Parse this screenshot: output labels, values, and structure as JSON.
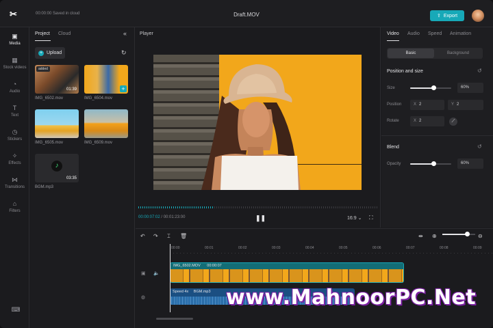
{
  "topbar": {
    "saved_text": "00:00:00 Saved in cloud",
    "title": "Draft.MOV",
    "export_label": "Export"
  },
  "rail": [
    {
      "label": "Media",
      "icon": "media-icon"
    },
    {
      "label": "Stock videos",
      "icon": "stock-icon"
    },
    {
      "label": "Audio",
      "icon": "audio-icon"
    },
    {
      "label": "Text",
      "icon": "text-icon"
    },
    {
      "label": "Stickers",
      "icon": "sticker-icon"
    },
    {
      "label": "Effects",
      "icon": "effects-icon"
    },
    {
      "label": "Transitions",
      "icon": "transitions-icon"
    },
    {
      "label": "Filters",
      "icon": "filters-icon"
    }
  ],
  "media": {
    "tabs": [
      "Project",
      "Cloud"
    ],
    "upload_label": "Upload",
    "items": [
      {
        "name": "IMG_6502.mov",
        "duration": "01:39",
        "badge": "added"
      },
      {
        "name": "IMG_6504.mov",
        "duration": ""
      },
      {
        "name": "IMG_6505.mov",
        "duration": ""
      },
      {
        "name": "IMG_6509.mov",
        "duration": ""
      },
      {
        "name": "BGM.mp3",
        "duration": "03:35"
      }
    ]
  },
  "player": {
    "label": "Player",
    "current_time": "00:00:07:02",
    "total_time": "/ 00:01:23:00",
    "ratio": "16:9",
    "progress": 0.31
  },
  "props": {
    "tabs": [
      "Video",
      "Audio",
      "Speed",
      "Animation"
    ],
    "segments": [
      "Basic",
      "Background"
    ],
    "position_section": "Position and size",
    "size_label": "Size",
    "size_value": "60%",
    "size_level": 0.6,
    "position_label": "Position",
    "pos_x_key": "X",
    "pos_x": "2",
    "pos_y_key": "Y",
    "pos_y": "2",
    "rotate_label": "Rotate",
    "rotate_key": "X",
    "rotate_value": "2",
    "blend_section": "Blend",
    "opacity_label": "Opacity",
    "opacity_value": "60%",
    "opacity_level": 0.6
  },
  "timeline": {
    "ticks": [
      "00:00",
      "00:01",
      "00:02",
      "00:03",
      "00:04",
      "00:05",
      "00:06",
      "00:07",
      "00:08",
      "00:09"
    ],
    "clip_name": "IMG_6502.MOV",
    "clip_duration": "00:00:07",
    "audio_speed": "Speed 4x",
    "audio_name": "BGM.mp3"
  },
  "watermark": "www.MahnoorPC.Net"
}
